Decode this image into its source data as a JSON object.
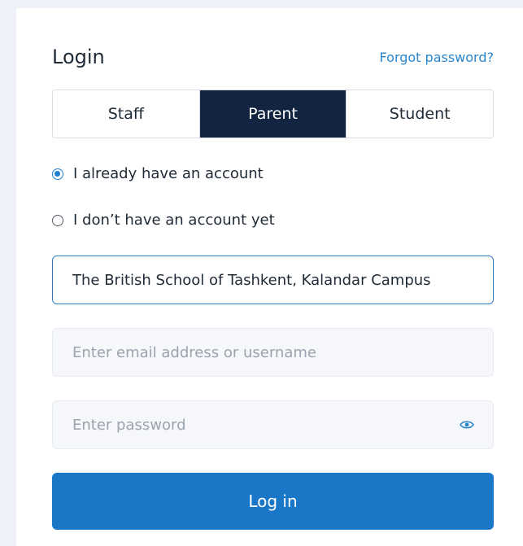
{
  "header": {
    "title": "Login",
    "forgot_password": "Forgot password?"
  },
  "roles": {
    "items": [
      "Staff",
      "Parent",
      "Student"
    ],
    "selected": "Parent"
  },
  "account_options": {
    "existing": "I already have an account",
    "new": "I don’t have an account yet",
    "selected": "existing"
  },
  "school": {
    "value": "The British School of Tashkent, Kalandar Campus"
  },
  "email": {
    "placeholder": "Enter email address or username",
    "value": ""
  },
  "password": {
    "placeholder": "Enter password",
    "value": "",
    "toggle_icon": "eye-icon"
  },
  "submit": {
    "label": "Log in"
  },
  "colors": {
    "accent": "#1a76c6",
    "active_tab": "#12243f",
    "link": "#2a86c9",
    "background": "#eef2f8"
  }
}
